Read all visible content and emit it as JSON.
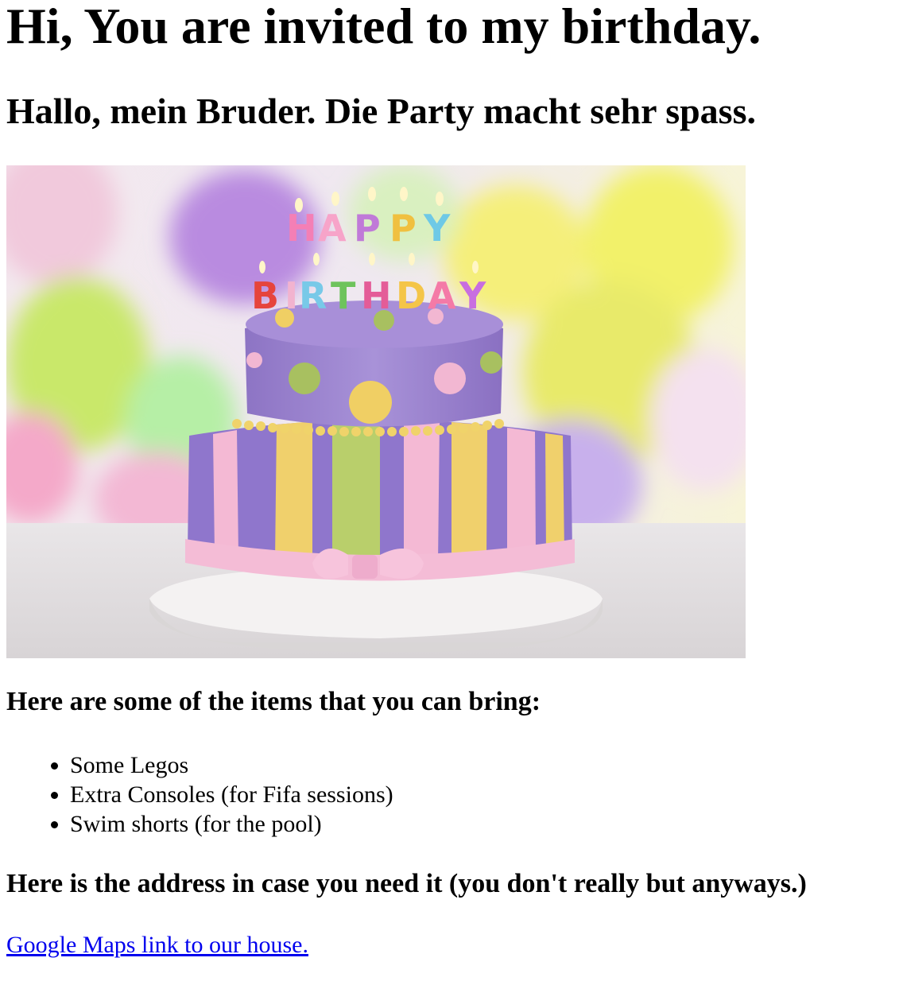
{
  "heading": "Hi, You are invited to my birthday.",
  "subheading": "Hallo, mein Bruder. Die Party macht sehr spass.",
  "image": {
    "candle_letters_top": [
      "H",
      "A",
      "P",
      "P",
      "Y"
    ],
    "candle_letters_bottom": [
      "B",
      "I",
      "R",
      "T",
      "H",
      "D",
      "A",
      "Y"
    ]
  },
  "bring_heading": "Here are some of the items that you can bring:",
  "items": [
    "Some Legos",
    "Extra Consoles (for Fifa sessions)",
    "Swim shorts (for the pool)"
  ],
  "address_heading": "Here is the address in case you need it (you don't really but anyways.)",
  "maps_link": "Google Maps link to our house."
}
